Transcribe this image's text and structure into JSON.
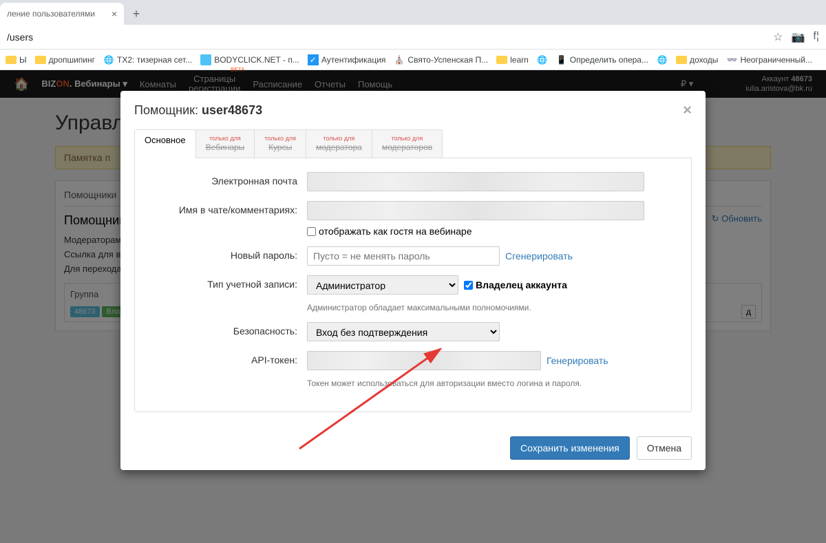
{
  "browser": {
    "tab_title": "ление пользователями",
    "url": "/users",
    "bookmarks": [
      {
        "label": "Ы",
        "type": "folder"
      },
      {
        "label": "дропшипинг",
        "type": "folder"
      },
      {
        "label": "ТХ2: тизерная сет...",
        "type": "globe"
      },
      {
        "label": "BODYCLICK.NET - п...",
        "type": "icon"
      },
      {
        "label": "Аутентификация",
        "type": "icon"
      },
      {
        "label": "Свято-Успенская П...",
        "type": "icon"
      },
      {
        "label": "learn",
        "type": "folder"
      },
      {
        "label": "",
        "type": "globe"
      },
      {
        "label": "Определить опера...",
        "type": "icon"
      },
      {
        "label": "",
        "type": "globe"
      },
      {
        "label": "доходы",
        "type": "folder"
      },
      {
        "label": "Неограниченный...",
        "type": "icon"
      }
    ]
  },
  "nav": {
    "brand_prefix": "BIZ",
    "brand_on": "ON",
    "brand_suffix": ". Вебинары",
    "items": [
      "Комнаты",
      "Страницы\nрегистрации",
      "Расписание",
      "Отчеты",
      "Помощь"
    ],
    "beta": "BETA",
    "account_label": "Аккаунт",
    "account_id": "48673",
    "account_email": "iulia.aristova@bk.ru"
  },
  "page": {
    "title": "Управле",
    "notice": "Памятка п",
    "tab": "Помощники",
    "panel_title": "Помощник",
    "line1": "Модераторам:",
    "line2": "Ссылка для вхо",
    "line3": "Для перехода н",
    "group": "Группа",
    "badge1": "48673",
    "badge2": "Влад",
    "refresh": "Обновить",
    "code_suffix": "д"
  },
  "modal": {
    "title_prefix": "Помощник: ",
    "title_user": "user48673",
    "tabs": {
      "main": "Основное",
      "restricted_hint": "только для\nмодераторов",
      "t1": "Вебинары",
      "t2": "Курсы",
      "t3": "",
      "t4": ""
    },
    "labels": {
      "email": "Электронная почта",
      "chatname": "Имя в чате/комментариях:",
      "guest": "отображать как гостя на вебинаре",
      "password": "Новый пароль:",
      "password_ph": "Пусто = не менять пароль",
      "generate_pwd": "Сгенерировать",
      "account_type": "Тип учетной записи:",
      "account_type_value": "Администратор",
      "owner": "Владелец аккаунта",
      "admin_help": "Администратор обладает максимальными полномочиями.",
      "security": "Безопасность:",
      "security_value": "Вход без подтверждения",
      "api": "API-токен:",
      "generate_token": "Генерировать",
      "token_help": "Токен может использоваться для авторизации вместо логина и пароля."
    },
    "buttons": {
      "save": "Сохранить изменения",
      "cancel": "Отмена"
    }
  }
}
